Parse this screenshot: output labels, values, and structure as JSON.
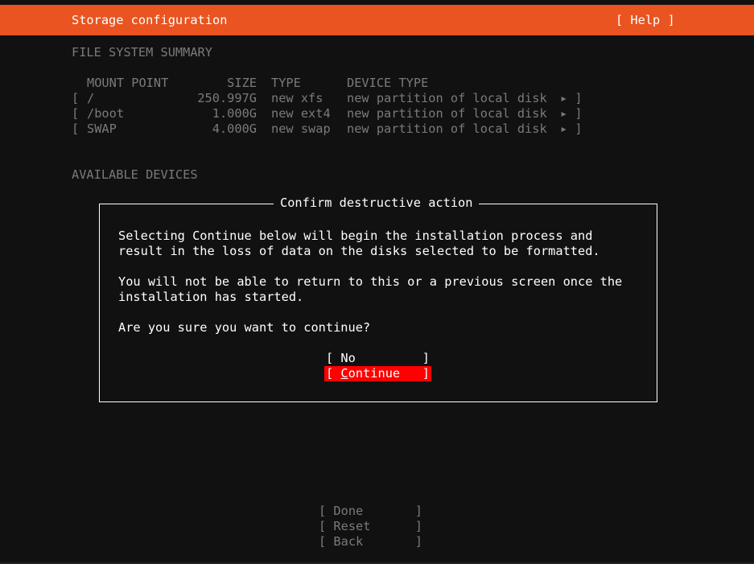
{
  "header": {
    "title": "Storage configuration",
    "help_label": "[ Help ]"
  },
  "filesystem_summary": {
    "label": "FILE SYSTEM SUMMARY",
    "columns": {
      "mount": "MOUNT POINT",
      "size": "SIZE",
      "type": "TYPE",
      "device_type": "DEVICE TYPE"
    },
    "rows": [
      {
        "bracket": "[",
        "mount": "/",
        "size": "250.997G",
        "type": "new xfs",
        "device_type": "new partition of local disk",
        "end": "▸ ]"
      },
      {
        "bracket": "[",
        "mount": "/boot",
        "size": "1.000G",
        "type": "new ext4",
        "device_type": "new partition of local disk",
        "end": "▸ ]"
      },
      {
        "bracket": "[",
        "mount": "SWAP",
        "size": "4.000G",
        "type": "new swap",
        "device_type": "new partition of local disk",
        "end": "▸ ]"
      }
    ]
  },
  "available_devices": {
    "label": "AVAILABLE DEVICES"
  },
  "dialog": {
    "title": "Confirm destructive action",
    "para1_line1": "Selecting Continue below will begin the installation process and",
    "para1_line2": "result in the loss of data on the disks selected to be formatted.",
    "para2_line1": "You will not be able to return to this or a previous screen once the",
    "para2_line2": "installation has started.",
    "question": "Are you sure you want to continue?",
    "no_label": "[ No         ]",
    "continue_prefix": "[ ",
    "continue_hotkey": "C",
    "continue_rest": "ontinue   ]"
  },
  "bottom_buttons": {
    "done": "[ Done       ]",
    "reset": "[ Reset      ]",
    "back": "[ Back       ]"
  },
  "colors": {
    "accent": "#e95420",
    "selected": "#ff0000",
    "background": "#111111",
    "dim_text": "#7a7a7a"
  }
}
